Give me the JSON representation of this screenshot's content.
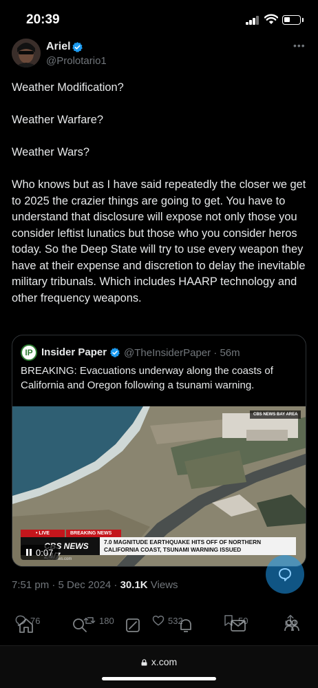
{
  "status_bar": {
    "time": "20:39",
    "battery_level": 0.3
  },
  "author": {
    "name": "Ariel",
    "handle": "@Prolotario1",
    "verified": true
  },
  "tweet": {
    "paragraphs": [
      "Weather Modification?",
      "Weather Warfare?",
      "Weather Wars?",
      "Who knows but as I have said repeatedly the closer we get to 2025 the crazier things are going to get. You have to understand that disclosure will expose not only those you consider leftist lunatics but those who you consider heros today. So the Deep State will try to use every weapon they have at their expense and discretion to delay the inevitable military tribunals. Which includes HAARP technology and other frequency weapons."
    ]
  },
  "quote": {
    "avatar_text": "IP",
    "name": "Insider Paper",
    "handle_time": "@TheInsiderPaper · 56m",
    "text": "BREAKING: Evacuations underway along the coasts of California and Oregon following a tsunami warning.",
    "video": {
      "bug": "CBS NEWS BAY AREA",
      "live_label": "• LIVE",
      "breaking_label": "BREAKING NEWS",
      "network": "CBS NEWS 24/7",
      "headline": "7.0 MAGNITUDE EARTHQUAKE HITS OFF OF NORTHERN CALIFORNIA COAST, TSUNAMI WARNING ISSUED",
      "site": "cbsnews.com",
      "timer": "0:07"
    }
  },
  "meta": {
    "time_date": "7:51 pm · 5 Dec 2024 · ",
    "views_count": "30.1K",
    "views_label": " Views"
  },
  "actions": {
    "replies": "76",
    "reposts": "180",
    "likes": "532",
    "bookmarks": "50"
  },
  "browser": {
    "url": "x.com"
  },
  "colors": {
    "background": "#000000",
    "text": "#e7e9ea",
    "muted": "#71767b",
    "accent": "#1d9bf0",
    "border": "#2f3336"
  }
}
